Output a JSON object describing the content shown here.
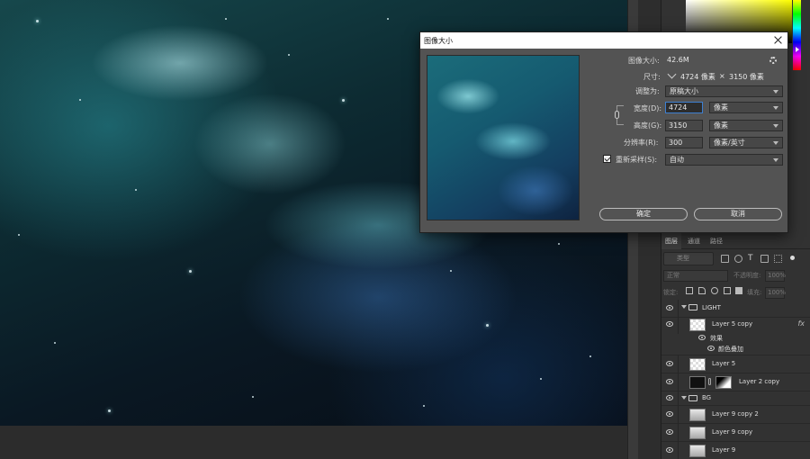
{
  "dialog": {
    "title": "图像大小",
    "image_size_label": "图像大小:",
    "image_size_value": "42.6M",
    "dimensions_label": "尺寸:",
    "dimensions_width": "4724 像素",
    "dimensions_sep": "×",
    "dimensions_height": "3150 像素",
    "fit_label": "调整为:",
    "fit_value": "原稿大小",
    "width_label": "宽度(D):",
    "width_value": "4724",
    "width_unit": "像素",
    "height_label": "高度(G):",
    "height_value": "3150",
    "height_unit": "像素",
    "resolution_label": "分辨率(R):",
    "resolution_value": "300",
    "resolution_unit": "像素/英寸",
    "resample_label": "重新采样(S):",
    "resample_value": "自动",
    "resample_checked": true,
    "ok_label": "确定",
    "cancel_label": "取消"
  },
  "layers_panel": {
    "tabs": [
      "图层",
      "通道",
      "路径"
    ],
    "active_tab": 0,
    "search_placeholder": "类型",
    "blend_mode": "正常",
    "opacity_label": "不透明度:",
    "opacity_value": "100%",
    "lock_label": "锁定:",
    "fill_label": "填充:",
    "fill_value": "100%",
    "layers": [
      {
        "name": "LIGHT",
        "kind": "group"
      },
      {
        "name": "Layer 5 copy",
        "kind": "layer",
        "fx": "fx"
      },
      {
        "name": "效果",
        "kind": "effect-header"
      },
      {
        "name": "颜色叠加",
        "kind": "effect"
      },
      {
        "name": "Layer 5",
        "kind": "layer"
      },
      {
        "name": "Layer 2 copy",
        "kind": "masked-layer"
      },
      {
        "name": "BG",
        "kind": "group"
      },
      {
        "name": "Layer 9 copy 2",
        "kind": "layer"
      },
      {
        "name": "Layer 9 copy",
        "kind": "layer"
      },
      {
        "name": "Layer 9",
        "kind": "layer"
      }
    ]
  },
  "colors": {
    "accent_focus": "#3d7fd1",
    "dialog_bg": "#535353",
    "panel_bg": "#323232"
  }
}
